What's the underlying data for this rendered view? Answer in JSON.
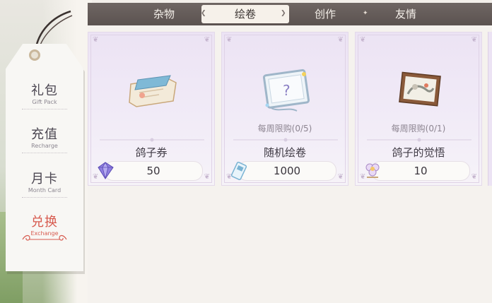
{
  "left_nav": {
    "items": [
      {
        "label": "礼包",
        "sublabel": "Gift Pack",
        "active": false
      },
      {
        "label": "充值",
        "sublabel": "Recharge",
        "active": false
      },
      {
        "label": "月卡",
        "sublabel": "Month Card",
        "active": false
      },
      {
        "label": "兑换",
        "sublabel": "Exchange",
        "active": true
      }
    ]
  },
  "top_tabs": {
    "items": [
      {
        "label": "杂物",
        "active": false
      },
      {
        "label": "绘卷",
        "active": true
      },
      {
        "label": "创作",
        "active": false
      },
      {
        "label": "友情",
        "active": false
      }
    ]
  },
  "cards": [
    {
      "name": "鸽子券",
      "limit": "",
      "price": "50",
      "art_icon": "ticket-icon",
      "currency_icon": "crystal-icon"
    },
    {
      "name": "随机绘卷",
      "limit": "每周限购(0/5)",
      "price": "1000",
      "art_icon": "picture-scroll-icon",
      "currency_icon": "ticket-currency-icon"
    },
    {
      "name": "鸽子的觉悟",
      "limit": "每周限购(0/1)",
      "price": "10",
      "art_icon": "framed-painting-icon",
      "currency_icon": "flower-token-icon"
    }
  ],
  "colors": {
    "accent_active": "#d75a4e",
    "topbar_bg": "#5b5250",
    "card_bg": "#ece3f4"
  }
}
